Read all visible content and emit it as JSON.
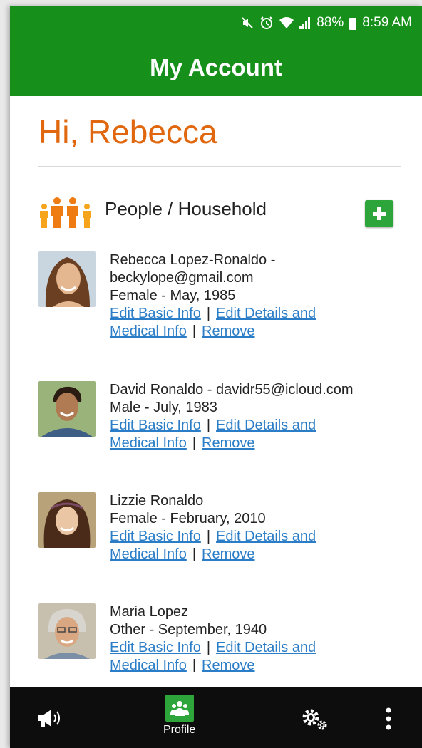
{
  "status_bar": {
    "battery": "88%",
    "time": "8:59 AM"
  },
  "header": {
    "title": "My Account"
  },
  "greeting": "Hi, Rebecca",
  "section": {
    "title": "People / Household"
  },
  "people": [
    {
      "lines": [
        "Rebecca Lopez-Ronaldo -",
        "beckylope@gmail.com",
        "Female - May, 1985"
      ]
    },
    {
      "lines": [
        "David Ronaldo - davidr55@icloud.com",
        "Male - July, 1983"
      ]
    },
    {
      "lines": [
        "Lizzie Ronaldo",
        "Female - February, 2010"
      ]
    },
    {
      "lines": [
        "Maria Lopez",
        "Other - September, 1940"
      ]
    }
  ],
  "links": {
    "edit_basic": "Edit Basic Info",
    "edit_details_1": "Edit Details and",
    "edit_details_2": "Medical Info",
    "remove": "Remove",
    "separator": "|"
  },
  "bottom_nav": {
    "profile_label": "Profile"
  },
  "colors": {
    "brand_green": "#16901a",
    "accent_orange": "#e0670e",
    "link_blue": "#2a7dc6",
    "button_green": "#2ea53a"
  },
  "icons": [
    "mute-icon",
    "alarm-icon",
    "wifi-icon",
    "signal-icon",
    "battery-icon",
    "family-icon",
    "add-icon",
    "announcement-icon",
    "people-icon",
    "settings-icon",
    "more-icon"
  ]
}
